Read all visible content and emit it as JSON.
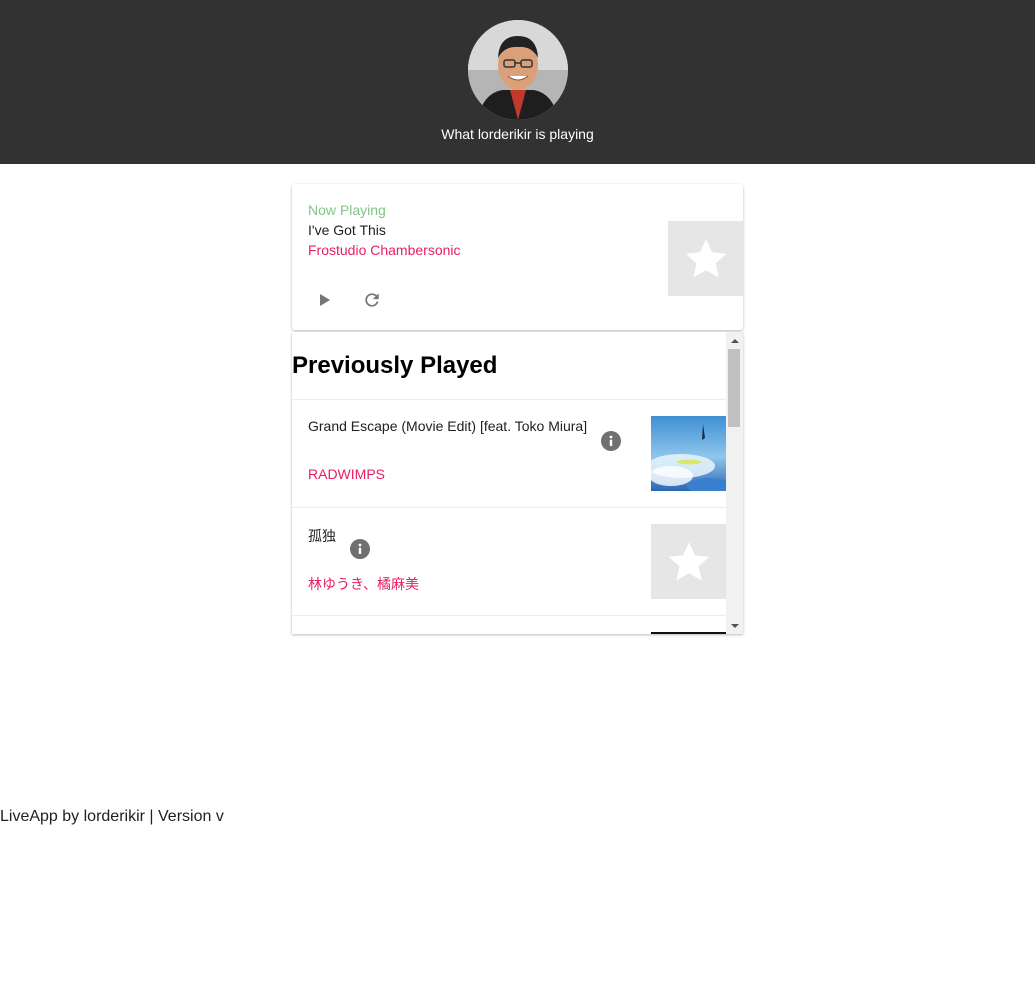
{
  "header": {
    "title": "What lorderikir is playing",
    "avatar_alt": "profile photo"
  },
  "now_playing": {
    "label": "Now Playing",
    "title": "I've Got This",
    "artist": "Frostudio Chambersonic",
    "label_color": "#81c784",
    "artist_color": "#e91e63"
  },
  "history": {
    "heading": "Previously Played",
    "tracks": [
      {
        "title": "Grand Escape (Movie Edit) [feat. Toko Miura]",
        "artist": "RADWIMPS"
      },
      {
        "title": "孤独",
        "artist": "林ゆうき、橘麻美"
      },
      {
        "title": "",
        "artist": ""
      }
    ]
  },
  "footer": {
    "text": "LiveApp by lorderikir | Version v"
  },
  "colors": {
    "header_bg": "#323232",
    "accent": "#e91e63",
    "now_label": "#81c784"
  },
  "icons": [
    "play-icon",
    "refresh-icon",
    "star-icon",
    "info-icon",
    "scroll-up-icon",
    "scroll-down-icon"
  ]
}
